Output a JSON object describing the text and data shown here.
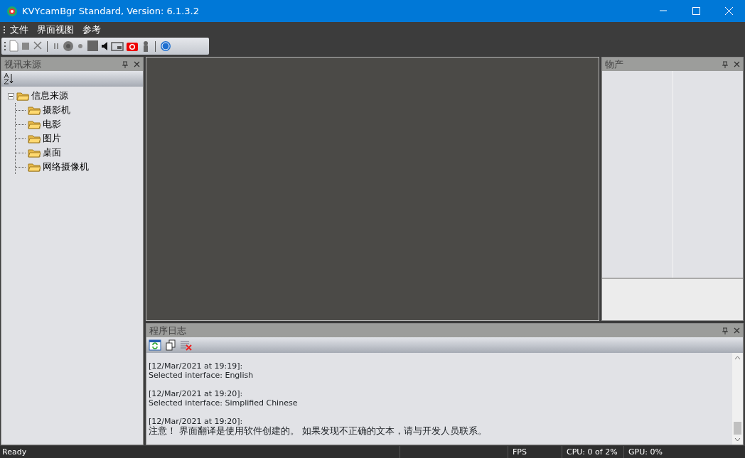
{
  "window": {
    "title": "KVYcamBgr Standard, Version: 6.1.3.2"
  },
  "menu": [
    "文件",
    "界面视图",
    "参考"
  ],
  "sources_panel": {
    "title": "视讯来源",
    "tree": [
      {
        "label": "信息来源",
        "expanded": true,
        "children": [
          {
            "label": "摄影机"
          },
          {
            "label": "电影"
          },
          {
            "label": "图片"
          },
          {
            "label": "桌面"
          },
          {
            "label": "网络摄像机"
          }
        ]
      }
    ]
  },
  "properties_panel": {
    "title": "物产"
  },
  "log_panel": {
    "title": "程序日志",
    "entries": [
      {
        "time": "[12/Mar/2021 at 19:19]:",
        "message": "Selected interface: English"
      },
      {
        "time": "[12/Mar/2021 at 19:20]:",
        "message": "Selected interface: Simplified Chinese"
      },
      {
        "time": "[12/Mar/2021 at 19:20]:",
        "message": "注意！ 界面翻译是使用软件创建的。 如果发现不正确的文本，请与开发人员联系。"
      }
    ]
  },
  "status_bar": {
    "status": "Ready",
    "fps": "FPS",
    "cpu": "CPU: 0 of 2%",
    "gpu": "GPU: 0%"
  }
}
